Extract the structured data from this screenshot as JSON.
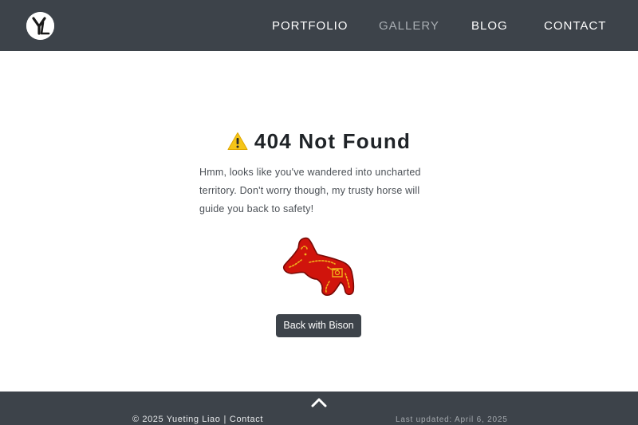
{
  "header": {
    "logo_text": "YL",
    "nav": [
      {
        "label": "PORTFOLIO",
        "active": false
      },
      {
        "label": "GALLERY",
        "active": true
      },
      {
        "label": "BLOG",
        "active": false
      },
      {
        "label": "CONTACT",
        "active": false
      }
    ]
  },
  "main": {
    "title_icon": "warning-icon",
    "title": "404 Not Found",
    "description": "Hmm, looks like you've wandered into uncharted territory. Don't worry though, my trusty horse will guide you back to safety!",
    "image_icon": "horse-icon",
    "back_button_label": "Back with Bison"
  },
  "footer": {
    "scroll_top_icon": "chevron-up-icon",
    "copyright": "© 2025 Yueting Liao",
    "separator": "|",
    "contact_label": "Contact",
    "last_updated": "Last updated: April 6, 2025"
  },
  "colors": {
    "header_bg": "#3d434a",
    "footer_bg": "#3d434a",
    "button_bg": "#3d434a",
    "nav_muted": "#a9aeb3",
    "warning": "#f5c518",
    "horse_red": "#d0140c",
    "horse_gold": "#f2b21b"
  }
}
